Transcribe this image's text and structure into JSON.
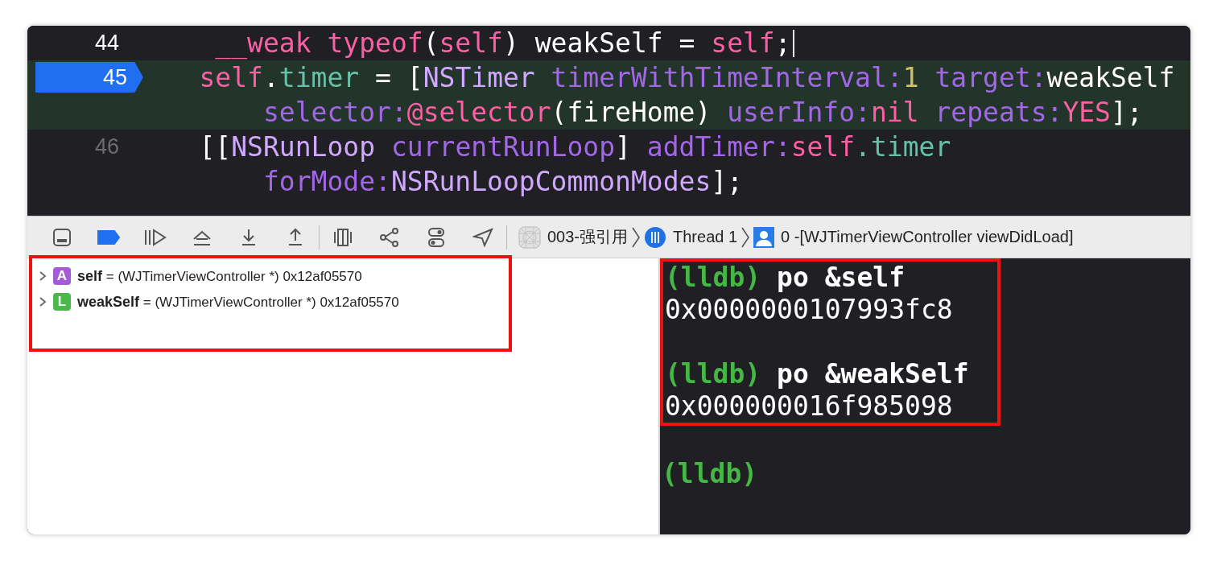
{
  "editor": {
    "lines": [
      {
        "number": "44",
        "current": false,
        "dimmed": false,
        "cursor": true,
        "rows": [
          {
            "tokens": [
              {
                "text": "     __weak typeof",
                "kind": "keyword"
              },
              {
                "text": "(",
                "kind": "plain"
              },
              {
                "text": "self",
                "kind": "keyword"
              },
              {
                "text": ") weakSelf = ",
                "kind": "plain"
              },
              {
                "text": "self",
                "kind": "keyword"
              },
              {
                "text": ";",
                "kind": "plain"
              }
            ]
          }
        ]
      },
      {
        "number": "45",
        "current": true,
        "dimmed": false,
        "cursor": false,
        "rows": [
          {
            "tokens": [
              {
                "text": "    self",
                "kind": "keyword"
              },
              {
                "text": ".",
                "kind": "plain"
              },
              {
                "text": "timer",
                "kind": "property"
              },
              {
                "text": " = [",
                "kind": "plain"
              },
              {
                "text": "NSTimer ",
                "kind": "class"
              },
              {
                "text": "timerWithTimeInterval:",
                "kind": "method"
              },
              {
                "text": "1 ",
                "kind": "number"
              },
              {
                "text": "target:",
                "kind": "method"
              },
              {
                "text": "weakSelf",
                "kind": "plain"
              }
            ]
          },
          {
            "tokens": [
              {
                "text": "        selector:",
                "kind": "method"
              },
              {
                "text": "@selector",
                "kind": "keyword"
              },
              {
                "text": "(fireHome) ",
                "kind": "plain"
              },
              {
                "text": "userInfo:",
                "kind": "method"
              },
              {
                "text": "nil ",
                "kind": "keyword"
              },
              {
                "text": "repeats:",
                "kind": "method"
              },
              {
                "text": "YES",
                "kind": "keyword"
              },
              {
                "text": "];",
                "kind": "plain"
              }
            ]
          }
        ]
      },
      {
        "number": "46",
        "current": false,
        "dimmed": true,
        "cursor": false,
        "rows": [
          {
            "tokens": [
              {
                "text": "    [[",
                "kind": "plain"
              },
              {
                "text": "NSRunLoop ",
                "kind": "class"
              },
              {
                "text": "currentRunLoop",
                "kind": "method"
              },
              {
                "text": "] ",
                "kind": "plain"
              },
              {
                "text": "addTimer:",
                "kind": "method"
              },
              {
                "text": "self",
                "kind": "keyword"
              },
              {
                "text": ".timer",
                "kind": "property"
              }
            ]
          },
          {
            "tokens": [
              {
                "text": "        forMode:",
                "kind": "method"
              },
              {
                "text": "NSRunLoopCommonModes",
                "kind": "class"
              },
              {
                "text": "];",
                "kind": "plain"
              }
            ]
          }
        ]
      }
    ]
  },
  "debug_bar": {
    "buttons": [
      {
        "kind": "console",
        "on": false
      },
      {
        "kind": "breakpoints",
        "on": true
      },
      {
        "kind": "continue",
        "on": false
      },
      {
        "kind": "step-over",
        "on": false
      },
      {
        "kind": "step-into",
        "on": false
      },
      {
        "kind": "step-out",
        "on": false
      },
      {
        "kind": "view-debugger",
        "on": false
      },
      {
        "kind": "memory-graph",
        "on": false
      },
      {
        "kind": "environment",
        "on": false
      },
      {
        "kind": "location",
        "on": false
      }
    ],
    "breadcrumbs": [
      {
        "kind": "app",
        "label": "003-强引用"
      },
      {
        "kind": "thread",
        "label": "Thread 1"
      },
      {
        "kind": "frame",
        "label": "0 -[WJTimerViewController viewDidLoad]"
      }
    ]
  },
  "variables": {
    "highlighted": true,
    "items": [
      {
        "badge": "A",
        "color": "#a35bd6",
        "name": "self",
        "value": "= (WJTimerViewController *) 0x12af05570",
        "expanded": false
      },
      {
        "badge": "L",
        "color": "#4cb84c",
        "name": "weakSelf",
        "value": "= (WJTimerViewController *) 0x12af05570",
        "expanded": false
      }
    ]
  },
  "console": {
    "groups": [
      {
        "prompt": "(lldb)",
        "command": "po &self",
        "output": "0x0000000107993fc8",
        "highlighted": true
      },
      {
        "prompt": "(lldb)",
        "command": "po &weakSelf",
        "output": "0x000000016f985098",
        "highlighted": true
      },
      {
        "prompt": "(lldb)",
        "highlighted": false
      }
    ]
  }
}
